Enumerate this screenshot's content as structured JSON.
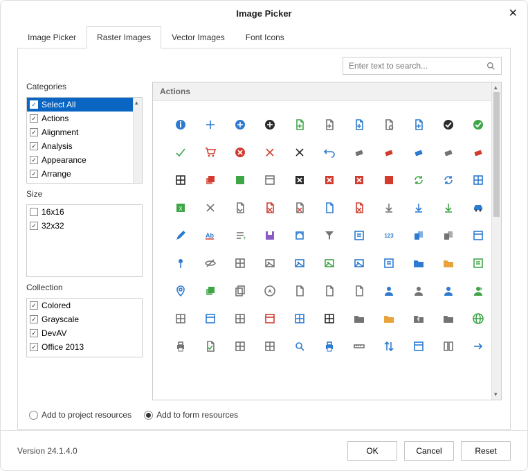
{
  "window": {
    "title": "Image Picker"
  },
  "tabs": [
    "Image Picker",
    "Raster Images",
    "Vector Images",
    "Font Icons"
  ],
  "active_tab": 1,
  "search": {
    "placeholder": "Enter text to search..."
  },
  "categories": {
    "label": "Categories",
    "items": [
      {
        "label": "Select All",
        "checked": true,
        "selected": true
      },
      {
        "label": "Actions",
        "checked": true
      },
      {
        "label": "Alignment",
        "checked": true
      },
      {
        "label": "Analysis",
        "checked": true
      },
      {
        "label": "Appearance",
        "checked": true
      },
      {
        "label": "Arrange",
        "checked": true
      }
    ]
  },
  "size": {
    "label": "Size",
    "items": [
      {
        "label": "16x16",
        "checked": false
      },
      {
        "label": "32x32",
        "checked": true
      }
    ]
  },
  "collection": {
    "label": "Collection",
    "items": [
      {
        "label": "Colored",
        "checked": true
      },
      {
        "label": "Grayscale",
        "checked": true
      },
      {
        "label": "DevAV",
        "checked": true
      },
      {
        "label": "Office 2013",
        "checked": true
      }
    ]
  },
  "icon_section": {
    "title": "Actions"
  },
  "radio": {
    "project": "Add to project resources",
    "form": "Add to form resources",
    "selected": "form"
  },
  "footer": {
    "version": "Version 24.1.4.0",
    "ok": "OK",
    "cancel": "Cancel",
    "reset": "Reset"
  },
  "icons": [
    [
      "info-blue",
      "plus-blue",
      "add-circle-blue",
      "add-circle-black",
      "doc-add-green",
      "doc-add-gray",
      "doc-add-blue",
      "doc-gear",
      "doc-plus-blue",
      "check-circle-black",
      "check-circle-green"
    ],
    [
      "check-green",
      "cart-red",
      "error-red",
      "x-red",
      "x-black",
      "undo-blue",
      "eraser-gray",
      "eraser-red",
      "eraser-blue",
      "eraser-sparkle",
      "eraser-red2"
    ],
    [
      "grid-black",
      "layers-red",
      "square-green",
      "window-gray",
      "square-x-black",
      "square-x-red",
      "square-x-red2",
      "square-red",
      "refresh-green",
      "refresh-blue",
      "table-blue"
    ],
    [
      "xls-green",
      "x-gray",
      "doc-arrow",
      "doc-x-red",
      "doc-x-gray",
      "doc-blue",
      "doc-x-red2",
      "download-gray",
      "download-blue",
      "download-green",
      "car-blue"
    ],
    [
      "pencil-blue",
      "ab-text",
      "list-plus",
      "save-purple",
      "box-blue",
      "funnel-gray",
      "note-blue",
      "123-blue",
      "tabs-blue",
      "tabs-dark",
      "window-blue"
    ],
    [
      "pin-blue",
      "eye-off",
      "grid3-gray",
      "image-gray",
      "image-blue",
      "image-green",
      "image2-blue",
      "note2-blue",
      "folder-blue",
      "folder-yellow",
      "note-green"
    ],
    [
      "marker-blue",
      "layers-green",
      "copy-gray",
      "compass",
      "doc-outline",
      "doc-gray",
      "doc-blank",
      "user-blue",
      "user-gray",
      "user2-blue",
      "users-green"
    ],
    [
      "grid-gray",
      "panel-blue",
      "grid2-gray",
      "window-red",
      "calc-blue",
      "grid-black2",
      "folder2-gray",
      "folder2-yellow",
      "folder-up",
      "folder-user",
      "globe-green"
    ],
    [
      "printer-gray",
      "doc-check",
      "grid4-gray",
      "calc2-gray",
      "search-blue",
      "printer-blue",
      "ruler-gray",
      "sort-blue",
      "panel2-blue",
      "book-gray",
      "arrow-blue"
    ]
  ],
  "colors": {
    "blue": "#2d7bd0",
    "green": "#3fa648",
    "red": "#d23b2e",
    "black": "#2b2b2b",
    "gray": "#737373",
    "yellow": "#e8a33d",
    "purple": "#8a5bc2"
  }
}
